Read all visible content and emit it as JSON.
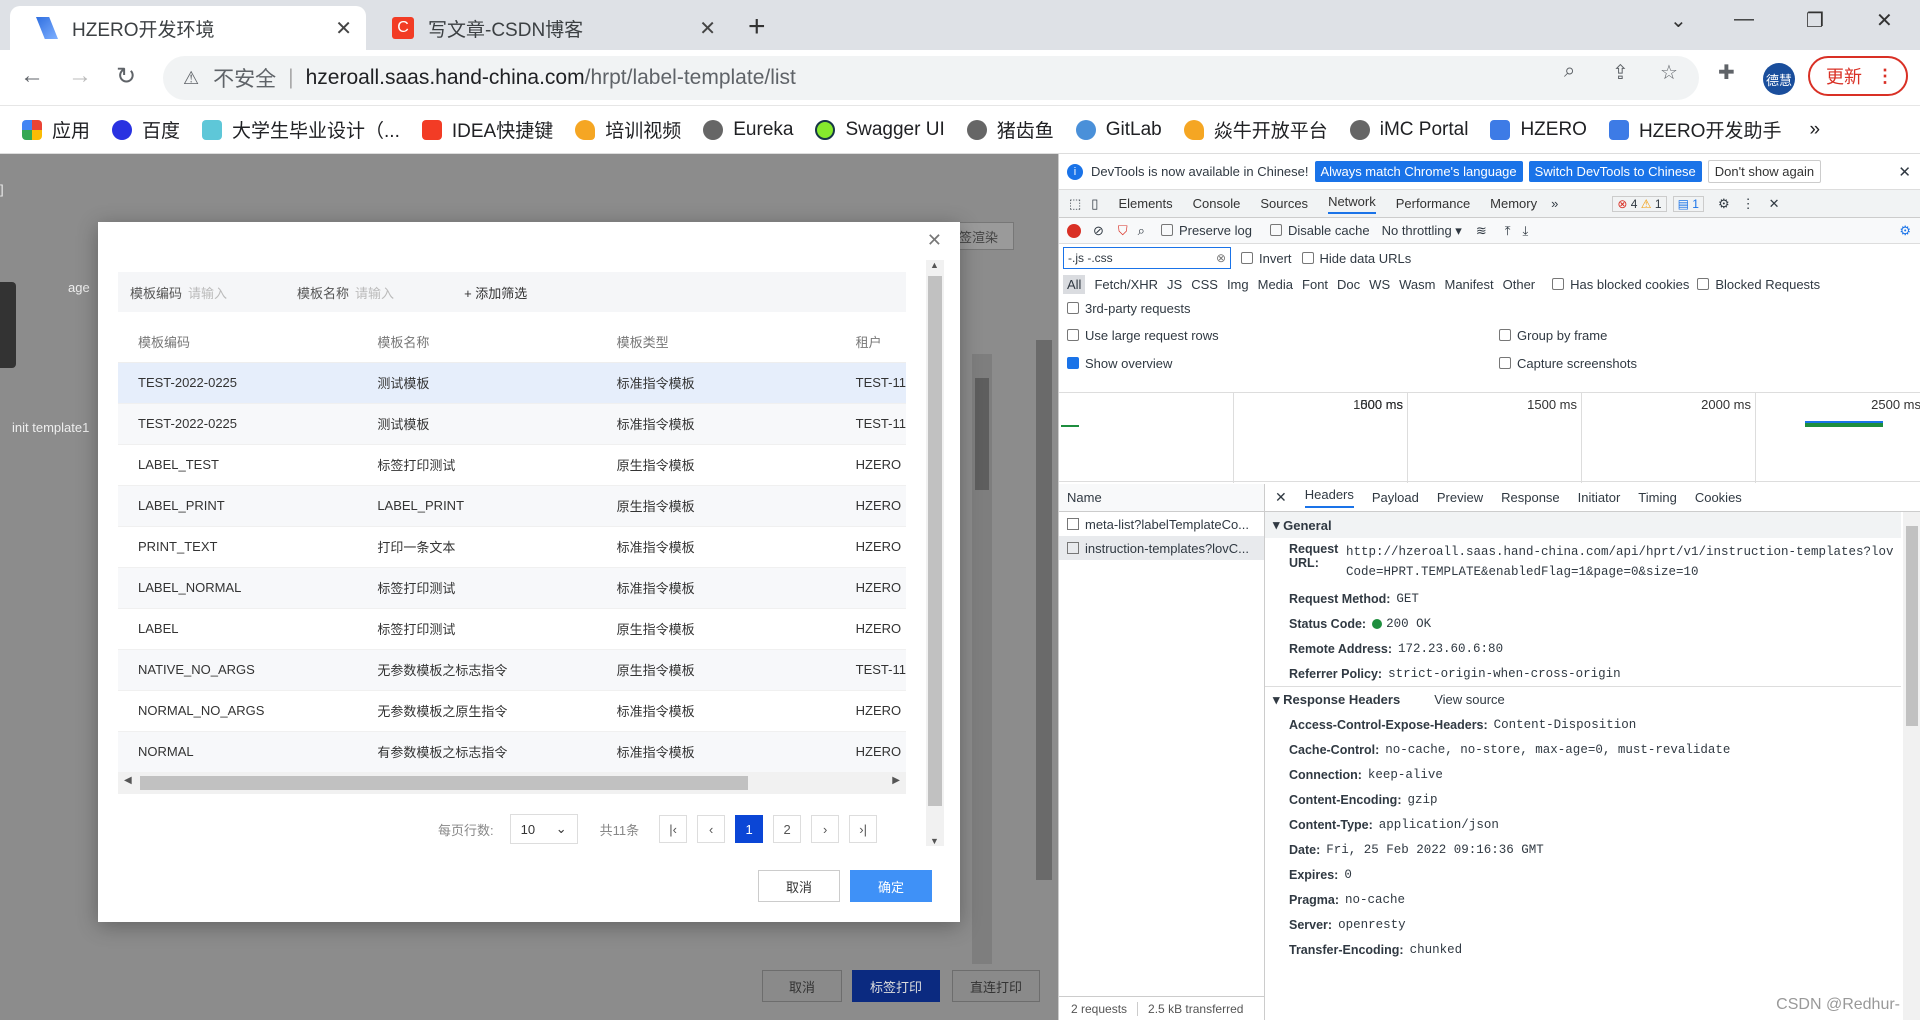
{
  "tabs": [
    {
      "title": "HZERO开发环境",
      "active": true
    },
    {
      "title": "写文章-CSDN博客",
      "active": false
    }
  ],
  "omnibox": {
    "insecure": "不安全",
    "host": "hzeroall.saas.hand-china.com",
    "path": "/hrpt/label-template/list"
  },
  "avatar": "德慧",
  "update_label": "更新",
  "bookmarks": [
    "应用",
    "百度",
    "大学生毕业设计（...",
    "IDEA快捷键",
    "培训视频",
    "Eureka",
    "Swagger UI",
    "猪齿鱼",
    "GitLab",
    "焱牛开放平台",
    "iMC Portal",
    "HZERO",
    "HZERO开发助手"
  ],
  "page_bg": {
    "age": "age",
    "init": "init template1",
    "render": "标签渲染",
    "bracket": "]"
  },
  "modal": {
    "filter": {
      "code_label": "模板编码",
      "code_ph": "请输入",
      "name_label": "模板名称",
      "name_ph": "请输入",
      "add": "+ 添加筛选"
    },
    "columns": [
      "模板编码",
      "模板名称",
      "模板类型",
      "租户"
    ],
    "rows": [
      [
        "TEST-2022-0225",
        "测试模板",
        "标准指令模板",
        "TEST-11"
      ],
      [
        "TEST-2022-0225",
        "测试模板",
        "标准指令模板",
        "TEST-11"
      ],
      [
        "LABEL_TEST",
        "标签打印测试",
        "原生指令模板",
        "HZERO"
      ],
      [
        "LABEL_PRINT",
        "LABEL_PRINT",
        "原生指令模板",
        "HZERO"
      ],
      [
        "PRINT_TEXT",
        "打印一条文本",
        "标准指令模板",
        "HZERO"
      ],
      [
        "LABEL_NORMAL",
        "标签打印测试",
        "标准指令模板",
        "HZERO"
      ],
      [
        "LABEL",
        "标签打印测试",
        "原生指令模板",
        "HZERO"
      ],
      [
        "NATIVE_NO_ARGS",
        "无参数模板之标志指令",
        "原生指令模板",
        "TEST-11"
      ],
      [
        "NORMAL_NO_ARGS",
        "无参数模板之原生指令",
        "标准指令模板",
        "HZERO"
      ],
      [
        "NORMAL",
        "有参数模板之标志指令",
        "标准指令模板",
        "HZERO"
      ]
    ],
    "pager": {
      "per_page_label": "每页行数:",
      "per_page": "10",
      "total": "共11条",
      "pages": [
        "1",
        "2"
      ]
    },
    "cancel": "取消",
    "ok": "确定"
  },
  "page_buttons": {
    "cancel": "取消",
    "print": "标签打印",
    "direct": "直连打印"
  },
  "devtools": {
    "info": "DevTools is now available in Chinese!",
    "btn_match": "Always match Chrome's language",
    "btn_switch": "Switch DevTools to Chinese",
    "btn_dont": "Don't show again",
    "tabs": [
      "Elements",
      "Console",
      "Sources",
      "Network",
      "Performance",
      "Memory"
    ],
    "errors": "4",
    "warnings": "1",
    "messages": "1",
    "preserve_log": "Preserve log",
    "disable_cache": "Disable cache",
    "throttling": "No throttling",
    "filter_value": "-.js -.css",
    "invert": "Invert",
    "hide_data": "Hide data URLs",
    "types": [
      "All",
      "Fetch/XHR",
      "JS",
      "CSS",
      "Img",
      "Media",
      "Font",
      "Doc",
      "WS",
      "Wasm",
      "Manifest",
      "Other"
    ],
    "blocked_cookies": "Has blocked cookies",
    "blocked_requests": "Blocked Requests",
    "third_party": "3rd-party requests",
    "large_rows": "Use large request rows",
    "group_frame": "Group by frame",
    "show_overview": "Show overview",
    "capture": "Capture screenshots",
    "ticks": [
      "500 ms",
      "1000 ms",
      "1500 ms",
      "2000 ms",
      "2500 ms"
    ],
    "name_header": "Name",
    "requests": [
      "meta-list?labelTemplateCo...",
      "instruction-templates?lovC..."
    ],
    "status": "2 requests",
    "transferred": "2.5 kB transferred",
    "detail_tabs": [
      "Headers",
      "Payload",
      "Preview",
      "Response",
      "Initiator",
      "Timing",
      "Cookies"
    ],
    "general_title": "General",
    "general": [
      {
        "k": "Request URL:",
        "v": "http://hzeroall.saas.hand-china.com/api/hprt/v1/instruction-templates?lovCode=HPRT.TEMPLATE&enabledFlag=1&page=0&size=10"
      },
      {
        "k": "Request Method:",
        "v": "GET"
      },
      {
        "k": "Status Code:",
        "v": "200 OK"
      },
      {
        "k": "Remote Address:",
        "v": "172.23.60.6:80"
      },
      {
        "k": "Referrer Policy:",
        "v": "strict-origin-when-cross-origin"
      }
    ],
    "resp_title": "Response Headers",
    "view_source": "View source",
    "response": [
      {
        "k": "Access-Control-Expose-Headers:",
        "v": "Content-Disposition"
      },
      {
        "k": "Cache-Control:",
        "v": "no-cache, no-store, max-age=0, must-revalidate"
      },
      {
        "k": "Connection:",
        "v": "keep-alive"
      },
      {
        "k": "Content-Encoding:",
        "v": "gzip"
      },
      {
        "k": "Content-Type:",
        "v": "application/json"
      },
      {
        "k": "Date:",
        "v": "Fri, 25 Feb 2022 09:16:36 GMT"
      },
      {
        "k": "Expires:",
        "v": "0"
      },
      {
        "k": "Pragma:",
        "v": "no-cache"
      },
      {
        "k": "Server:",
        "v": "openresty"
      },
      {
        "k": "Transfer-Encoding:",
        "v": "chunked"
      }
    ],
    "watermark": "CSDN @Redhur-"
  }
}
